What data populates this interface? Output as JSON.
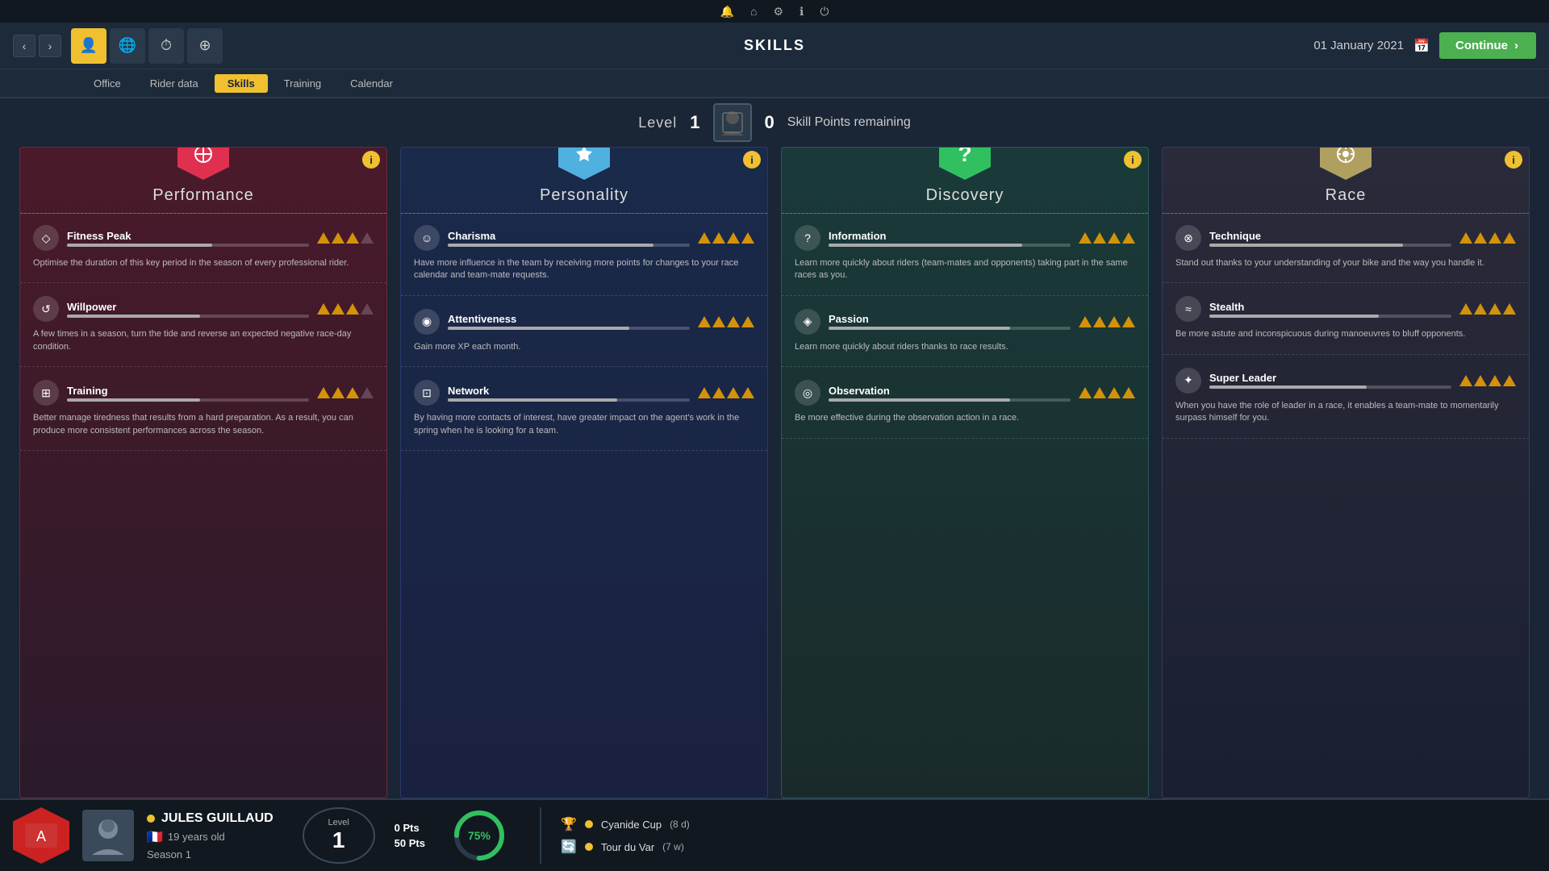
{
  "topbar": {
    "icons": [
      "🔔",
      "🏠",
      "⚙",
      "ℹ",
      "⏻"
    ]
  },
  "navbar": {
    "title": "SKILLS",
    "date": "01 January 2021",
    "continue_label": "Continue"
  },
  "subtabs": [
    "Office",
    "Rider data",
    "Skills",
    "Training",
    "Calendar"
  ],
  "active_subtab": "Skills",
  "level": {
    "label": "Level",
    "value": "1",
    "skill_points_label": "Skill Points remaining",
    "skill_points_value": "0"
  },
  "cards": [
    {
      "id": "performance",
      "title": "Performance",
      "icon": "⊕",
      "skills": [
        {
          "name": "Fitness Peak",
          "icon": "◇",
          "desc": "Optimise the duration of this key period in the season of every professional rider.",
          "filled": 3,
          "total": 4
        },
        {
          "name": "Willpower",
          "icon": "↺",
          "desc": "A few times in a season, turn the tide and reverse an expected negative race-day condition.",
          "filled": 3,
          "total": 4
        },
        {
          "name": "Training",
          "icon": "⊞",
          "desc": "Better manage tiredness that results from a hard preparation. As a result, you can produce more consistent performances across the season.",
          "filled": 3,
          "total": 4
        }
      ]
    },
    {
      "id": "personality",
      "title": "Personality",
      "icon": "✦",
      "skills": [
        {
          "name": "Charisma",
          "icon": "☺",
          "desc": "Have more influence in the team by receiving more points for changes to your race calendar and team-mate requests.",
          "filled": 4,
          "total": 4
        },
        {
          "name": "Attentiveness",
          "icon": "◉",
          "desc": "Gain more XP each month.",
          "filled": 4,
          "total": 4
        },
        {
          "name": "Network",
          "icon": "⊡",
          "desc": "By having more contacts of interest, have greater impact on the agent's work in the spring when he is looking for a team.",
          "filled": 4,
          "total": 4
        }
      ]
    },
    {
      "id": "discovery",
      "title": "Discovery",
      "icon": "?",
      "skills": [
        {
          "name": "Information",
          "icon": "?",
          "desc": "Learn more quickly about riders (team-mates and opponents) taking part in the same races as you.",
          "filled": 4,
          "total": 4
        },
        {
          "name": "Passion",
          "icon": "◈",
          "desc": "Learn more quickly about riders thanks to race results.",
          "filled": 4,
          "total": 4
        },
        {
          "name": "Observation",
          "icon": "◎",
          "desc": "Be more effective during the observation action in a race.",
          "filled": 4,
          "total": 4
        }
      ]
    },
    {
      "id": "race",
      "title": "Race",
      "icon": "⊙",
      "skills": [
        {
          "name": "Technique",
          "icon": "⊗",
          "desc": "Stand out thanks to your understanding of your bike and the way you handle it.",
          "filled": 4,
          "total": 4
        },
        {
          "name": "Stealth",
          "icon": "≈",
          "desc": "Be more astute and inconspicuous during manoeuvres to bluff opponents.",
          "filled": 4,
          "total": 4
        },
        {
          "name": "Super Leader",
          "icon": "✦",
          "desc": "When you have the role of leader in a race, it enables a team-mate to momentarily surpass himself for you.",
          "filled": 4,
          "total": 4
        }
      ]
    }
  ],
  "bottom": {
    "rider_name": "JULES GUILLAUD",
    "rider_age": "19 years old",
    "rider_season": "Season 1",
    "level_label": "Level",
    "level_value": "1",
    "pts_current": "0 Pts",
    "pts_total": "50 Pts",
    "progress_pct": "75%",
    "races": [
      {
        "icon": "🏆",
        "name": "Cyanide Cup",
        "days": "(8 d)"
      },
      {
        "icon": "🔄",
        "name": "Tour du Var",
        "days": "(7 w)"
      }
    ]
  }
}
